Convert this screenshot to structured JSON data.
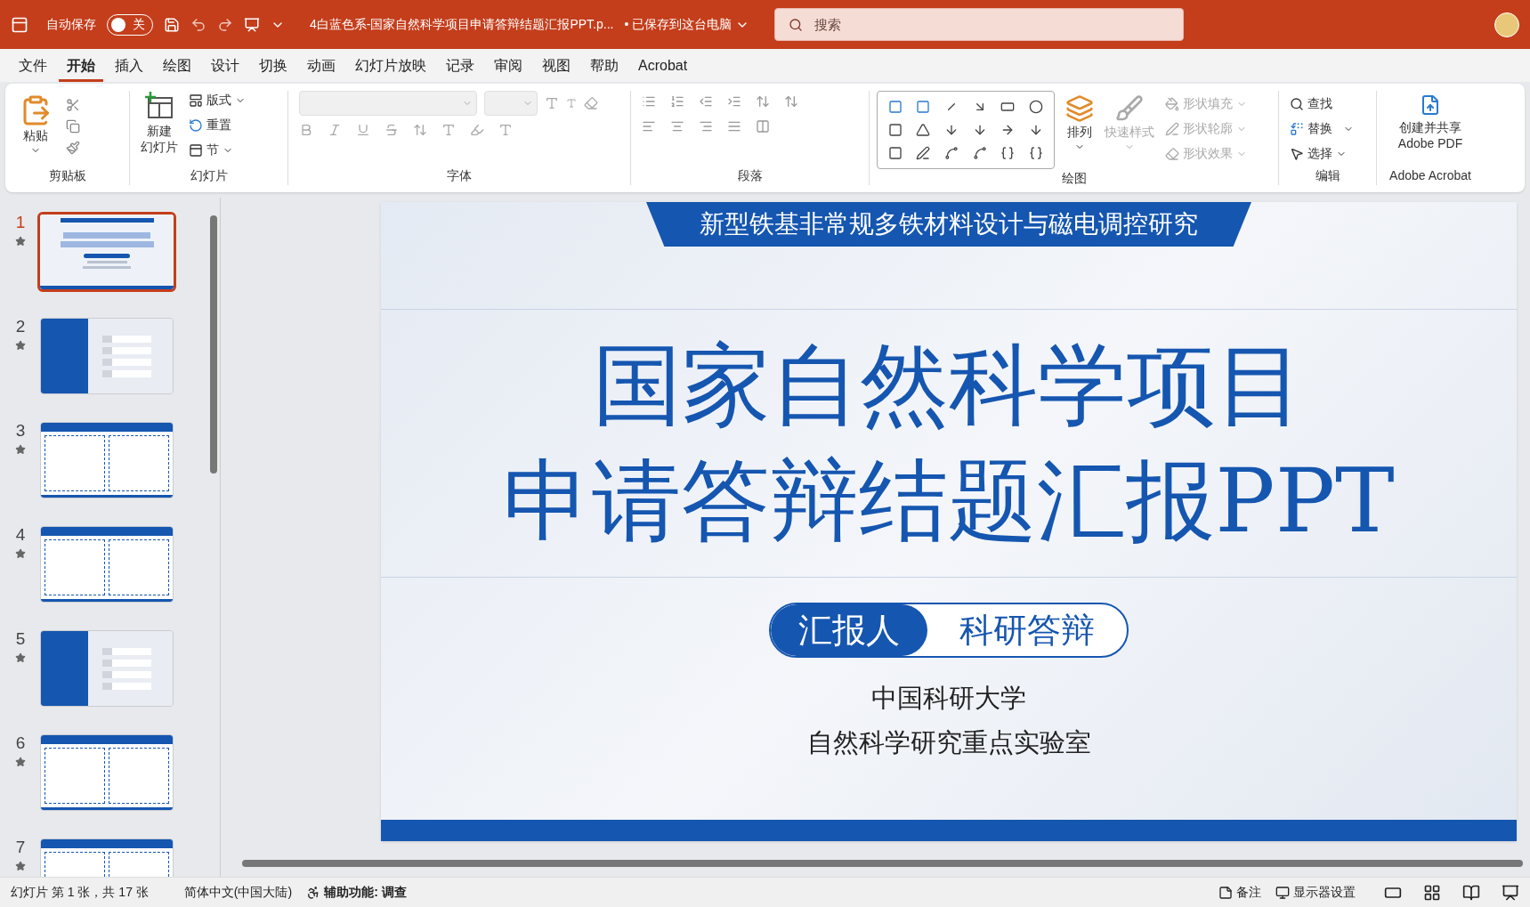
{
  "title_bar": {
    "autosave_label": "自动保存",
    "autosave": {
      "on": false,
      "label": "关"
    },
    "document_title": "4白蓝色系-国家自然科学项目申请答辩结题汇报PPT.p...",
    "save_status": "• 已保存到这台电脑",
    "search": {
      "placeholder": "搜索"
    }
  },
  "menu_tabs": [
    {
      "label": "文件",
      "selected": false
    },
    {
      "label": "开始",
      "selected": true
    },
    {
      "label": "插入",
      "selected": false
    },
    {
      "label": "绘图",
      "selected": false
    },
    {
      "label": "设计",
      "selected": false
    },
    {
      "label": "切换",
      "selected": false
    },
    {
      "label": "动画",
      "selected": false
    },
    {
      "label": "幻灯片放映",
      "selected": false
    },
    {
      "label": "记录",
      "selected": false
    },
    {
      "label": "审阅",
      "selected": false
    },
    {
      "label": "视图",
      "selected": false
    },
    {
      "label": "帮助",
      "selected": false
    },
    {
      "label": "Acrobat",
      "selected": false
    }
  ],
  "ribbon": {
    "clipboard": {
      "paste": "粘贴",
      "label": "剪贴板"
    },
    "slides": {
      "new_slide": [
        "新建",
        "幻灯片"
      ],
      "layout": "版式",
      "reset": "重置",
      "section": "节",
      "label": "幻灯片"
    },
    "font": {
      "label": "字体",
      "disabled": true
    },
    "paragraph": {
      "label": "段落"
    },
    "drawing": {
      "arrange": "排列",
      "quick_styles": {
        "label": "快速样式",
        "disabled": true
      },
      "format_items": [
        {
          "label": "形状填充",
          "disabled": true
        },
        {
          "label": "形状轮廓",
          "disabled": true
        },
        {
          "label": "形状效果",
          "disabled": true
        }
      ],
      "label": "绘图"
    },
    "editing": {
      "find": "查找",
      "replace": "替换",
      "select": "选择",
      "label": "编辑"
    },
    "acrobat": {
      "create": [
        "创建并共享",
        "Adobe PDF"
      ],
      "label": "Adobe Acrobat"
    }
  },
  "thumbnails": [
    {
      "number": "1",
      "selected": true,
      "kind": "title"
    },
    {
      "number": "2",
      "selected": false,
      "kind": "outline"
    },
    {
      "number": "3",
      "selected": false,
      "kind": "content"
    },
    {
      "number": "4",
      "selected": false,
      "kind": "content"
    },
    {
      "number": "5",
      "selected": false,
      "kind": "outline"
    },
    {
      "number": "6",
      "selected": false,
      "kind": "content"
    },
    {
      "number": "7",
      "selected": false,
      "kind": "content"
    }
  ],
  "slide": {
    "header": "新型铁基非常规多铁材料设计与磁电调控研究",
    "title_lines": [
      "国家自然科学项目",
      "申请答辩结题汇报PPT"
    ],
    "presenter_label": "汇报人",
    "presenter_value": "科研答辩",
    "affiliation_lines": [
      "中国科研大学",
      "自然科学研究重点实验室"
    ]
  },
  "status_bar": {
    "slide_count": "幻灯片 第 1 张，共 17 张",
    "language": "简体中文(中国大陆)",
    "accessibility": "辅助功能: 调查",
    "notes": "备注",
    "display_settings": "显示器设置"
  }
}
